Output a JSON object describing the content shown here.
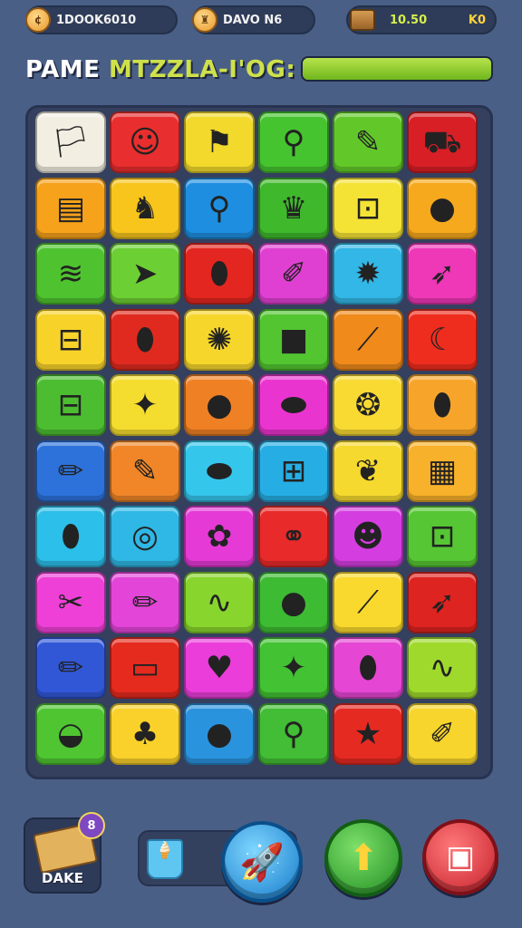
{
  "header": {
    "coins": "1DOOK6010",
    "player": "DAVO N6",
    "score": "10.50",
    "score_extra": "K0"
  },
  "title": {
    "part1": "PAME",
    "part2": "MTZZLA-I'OG:",
    "progress_fraction": 1.0
  },
  "board": {
    "rows": 10,
    "cols": 6,
    "tiles": [
      {
        "color": "#f2eee2",
        "icon": "flag-icon",
        "glyph": "🏳"
      },
      {
        "color": "#e82e2e",
        "icon": "smiley-icon",
        "glyph": "☺"
      },
      {
        "color": "#f2d92b",
        "icon": "flag-icon",
        "glyph": "⚑"
      },
      {
        "color": "#46c42f",
        "icon": "magnifier-icon",
        "glyph": "⚲"
      },
      {
        "color": "#62c82a",
        "icon": "feather-icon",
        "glyph": "✎"
      },
      {
        "color": "#d81f26",
        "icon": "cart-icon",
        "glyph": "⛟"
      },
      {
        "color": "#f6a21a",
        "icon": "book-icon",
        "glyph": "▤"
      },
      {
        "color": "#f7c51c",
        "icon": "goat-icon",
        "glyph": "♞"
      },
      {
        "color": "#1e8fe0",
        "icon": "magnifier-icon",
        "glyph": "⚲"
      },
      {
        "color": "#3fb82c",
        "icon": "crown-icon",
        "glyph": "♛"
      },
      {
        "color": "#f4e335",
        "icon": "lock-icon",
        "glyph": "⊡"
      },
      {
        "color": "#f7a91d",
        "icon": "orange-icon",
        "glyph": "●"
      },
      {
        "color": "#4fc32f",
        "icon": "corn-icon",
        "glyph": "≋"
      },
      {
        "color": "#6ccf33",
        "icon": "fish-icon",
        "glyph": "➤"
      },
      {
        "color": "#e3261f",
        "icon": "bread-icon",
        "glyph": "⬮"
      },
      {
        "color": "#e040d2",
        "icon": "pencil-icon",
        "glyph": "✐"
      },
      {
        "color": "#32b7e6",
        "icon": "sun-icon",
        "glyph": "✹"
      },
      {
        "color": "#ee38b8",
        "icon": "feather-icon",
        "glyph": "➶"
      },
      {
        "color": "#f7d32a",
        "icon": "scroll-icon",
        "glyph": "⊟"
      },
      {
        "color": "#e02a1f",
        "icon": "bread-icon",
        "glyph": "⬮"
      },
      {
        "color": "#f7d62c",
        "icon": "gear-icon",
        "glyph": "✺"
      },
      {
        "color": "#52c530",
        "icon": "box-icon",
        "glyph": "■"
      },
      {
        "color": "#f08a1b",
        "icon": "feather-icon",
        "glyph": "⟋"
      },
      {
        "color": "#ef2d1e",
        "icon": "banana-icon",
        "glyph": "☾"
      },
      {
        "color": "#4cbd31",
        "icon": "scroll-icon",
        "glyph": "⊟"
      },
      {
        "color": "#f5dd2f",
        "icon": "leaf-icon",
        "glyph": "✦"
      },
      {
        "color": "#f08024",
        "icon": "apple-icon",
        "glyph": "●"
      },
      {
        "color": "#ea34cf",
        "icon": "capsule-icon",
        "glyph": "⬬"
      },
      {
        "color": "#f8da33",
        "icon": "shell-icon",
        "glyph": "❂"
      },
      {
        "color": "#f7a52a",
        "icon": "bean-icon",
        "glyph": "⬮"
      },
      {
        "color": "#2d72db",
        "icon": "crayon-icon",
        "glyph": "✏"
      },
      {
        "color": "#f08628",
        "icon": "pencil-icon",
        "glyph": "✎"
      },
      {
        "color": "#35c6ec",
        "icon": "eggplant-icon",
        "glyph": "⬬"
      },
      {
        "color": "#26aee4",
        "icon": "sign-icon",
        "glyph": "⊞"
      },
      {
        "color": "#f6d92e",
        "icon": "leaf-icon",
        "glyph": "❦"
      },
      {
        "color": "#f7b12a",
        "icon": "chocolate-icon",
        "glyph": "▦"
      },
      {
        "color": "#2cbfe9",
        "icon": "almond-icon",
        "glyph": "⬮"
      },
      {
        "color": "#2fb7e5",
        "icon": "donut-icon",
        "glyph": "◎"
      },
      {
        "color": "#e53ad6",
        "icon": "flower-icon",
        "glyph": "✿"
      },
      {
        "color": "#e92a2a",
        "icon": "tape-icon",
        "glyph": "⚭"
      },
      {
        "color": "#d43ee0",
        "icon": "cookie-icon",
        "glyph": "☻"
      },
      {
        "color": "#57c634",
        "icon": "lock-icon",
        "glyph": "⊡"
      },
      {
        "color": "#ee40d6",
        "icon": "candy-icon",
        "glyph": "✂"
      },
      {
        "color": "#e345d9",
        "icon": "crayon-icon",
        "glyph": "✏"
      },
      {
        "color": "#88d52d",
        "icon": "worm-icon",
        "glyph": "∿"
      },
      {
        "color": "#3dbb33",
        "icon": "plum-icon",
        "glyph": "●"
      },
      {
        "color": "#f9d92d",
        "icon": "feather-icon",
        "glyph": "⟋"
      },
      {
        "color": "#de2420",
        "icon": "feather-icon",
        "glyph": "➶"
      },
      {
        "color": "#3157d6",
        "icon": "pencil-icon",
        "glyph": "✏"
      },
      {
        "color": "#e52a1e",
        "icon": "scroll-icon",
        "glyph": "▭"
      },
      {
        "color": "#ea3dd9",
        "icon": "heart-icon",
        "glyph": "♥"
      },
      {
        "color": "#43c233",
        "icon": "star-icon",
        "glyph": "✦"
      },
      {
        "color": "#e546d4",
        "icon": "leaf-icon",
        "glyph": "⬮"
      },
      {
        "color": "#9fd92c",
        "icon": "worm-icon",
        "glyph": "∿"
      },
      {
        "color": "#4fc532",
        "icon": "melon-icon",
        "glyph": "◒"
      },
      {
        "color": "#f9d12a",
        "icon": "mushroom-icon",
        "glyph": "♣"
      },
      {
        "color": "#2a93dd",
        "icon": "orange-icon",
        "glyph": "●"
      },
      {
        "color": "#42bd35",
        "icon": "bone-icon",
        "glyph": "⚲"
      },
      {
        "color": "#e52a22",
        "icon": "star-icon",
        "glyph": "★"
      },
      {
        "color": "#f8d52c",
        "icon": "pencil-icon",
        "glyph": "✐"
      }
    ]
  },
  "bottom": {
    "deck_label": "DAKE",
    "deck_count": "8",
    "rocket_icon": "rocket-icon",
    "up_icon": "arrow-up-icon",
    "shop_icon": "shop-icon"
  }
}
